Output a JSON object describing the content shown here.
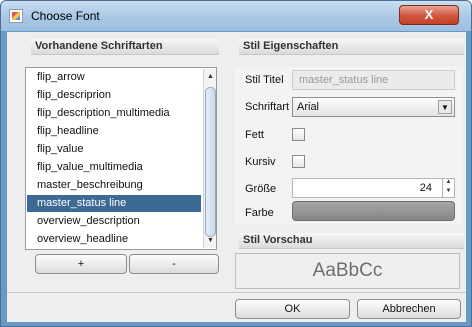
{
  "window": {
    "title": "Choose Font",
    "close_glyph": "X",
    "icon": "java-cup-icon"
  },
  "fonts_panel": {
    "header": "Vorhandene Schriftarten",
    "items": [
      "flip_arrow",
      "flip_descriprion",
      "flip_description_multimedia",
      "flip_headline",
      "flip_value",
      "flip_value_multimedia",
      "master_beschreibung",
      "master_status line",
      "overview_description",
      "overview_headline"
    ],
    "selected": "master_status line",
    "add_label": "+",
    "remove_label": "-"
  },
  "props_panel": {
    "header": "Stil Eigenschaften",
    "title_label": "Stil Titel",
    "title_value": "master_status line",
    "font_label": "Schriftart",
    "font_value": "Arial",
    "bold_label": "Fett",
    "bold_checked": false,
    "italic_label": "Kursiv",
    "italic_checked": false,
    "size_label": "Größe",
    "size_value": "24",
    "color_label": "Farbe",
    "color_value": "#8e8e8e"
  },
  "preview_panel": {
    "header": "Stil Vorschau",
    "sample": "AaBbCc"
  },
  "footer": {
    "ok_label": "OK",
    "cancel_label": "Abbrechen"
  },
  "colors": {
    "title_bar": "#a9c7e4",
    "selection": "#3d6a94",
    "close_button": "#c4402a"
  }
}
